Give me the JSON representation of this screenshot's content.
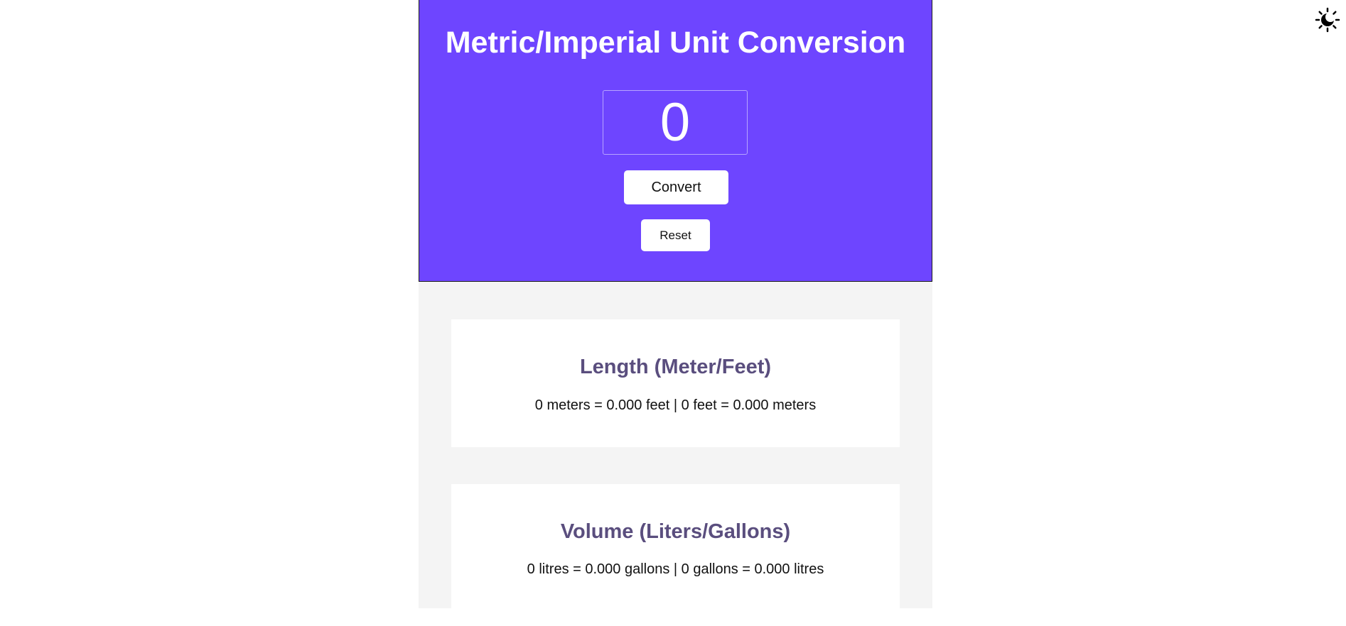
{
  "theme_toggle": {
    "icon": "sun-moon-icon"
  },
  "header": {
    "title": "Metric/Imperial Unit Conversion",
    "background_color": "#6e45ff"
  },
  "input": {
    "value": "0"
  },
  "buttons": {
    "convert_label": "Convert",
    "reset_label": "Reset"
  },
  "results": {
    "length": {
      "title": "Length (Meter/Feet)",
      "text": "0 meters = 0.000 feet | 0 feet = 0.000 meters"
    },
    "volume": {
      "title": "Volume (Liters/Gallons)",
      "text": "0 litres = 0.000 gallons | 0 gallons = 0.000 litres"
    }
  },
  "colors": {
    "accent": "#6e45ff",
    "card_heading": "#5a4e7e",
    "page_background": "#f4f4f4"
  }
}
